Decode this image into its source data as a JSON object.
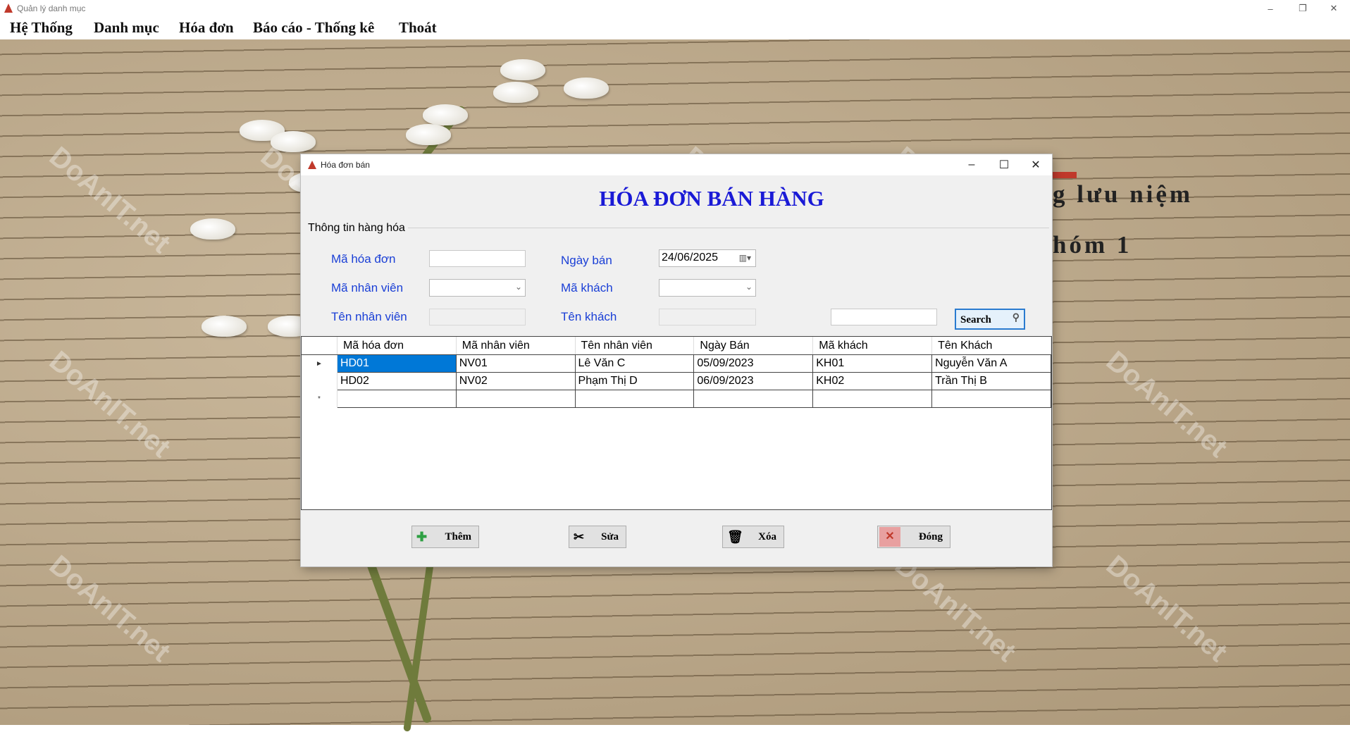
{
  "window": {
    "title": "Quản lý danh mục",
    "controls": {
      "minimize": "–",
      "maximize": "❐",
      "close": "✕"
    }
  },
  "menu": [
    {
      "label": "Hệ Thống"
    },
    {
      "label": "Danh mục"
    },
    {
      "label": "Hóa đơn"
    },
    {
      "label": "Báo cáo - Thống kê"
    },
    {
      "label": "Thoát"
    }
  ],
  "background": {
    "lines": [
      "g lưu niệm",
      "hóm 1"
    ]
  },
  "watermark": {
    "text": "DoAnIT.net"
  },
  "form": {
    "title": "Hóa đơn bán",
    "controls": {
      "minimize": "–",
      "maximize": "☐",
      "close": "✕"
    },
    "heading": "HÓA ĐƠN BÁN HÀNG",
    "group_label": "Thông tin hàng hóa",
    "fields": {
      "ma_hoa_don": {
        "label": "Mã hóa đơn",
        "value": ""
      },
      "ngay_ban": {
        "label": "Ngày bán",
        "value": "24/06/2025"
      },
      "ma_nhan_vien": {
        "label": "Mã nhân viên",
        "value": ""
      },
      "ma_khach": {
        "label": "Mã khách",
        "value": ""
      },
      "ten_nhan_vien": {
        "label": "Tên nhân viên",
        "value": ""
      },
      "ten_khach": {
        "label": "Tên khách",
        "value": ""
      },
      "search": {
        "value": ""
      }
    },
    "search_label": "Search",
    "grid": {
      "columns": [
        "Mã hóa đơn",
        "Mã nhân viên",
        "Tên nhân viên",
        "Ngày Bán",
        "Mã khách",
        "Tên Khách"
      ],
      "rows": [
        [
          "HD01",
          "NV01",
          "Lê Văn C",
          "05/09/2023",
          "KH01",
          "Nguyễn Văn A"
        ],
        [
          "HD02",
          "NV02",
          "Phạm Thị D",
          "06/09/2023",
          "KH02",
          "Trần Thị B"
        ]
      ],
      "current_row_marker": "►",
      "new_row_marker": "*"
    },
    "buttons": {
      "them": "Thêm",
      "sua": "Sửa",
      "xoa": "Xóa",
      "dong": "Đóng"
    }
  }
}
